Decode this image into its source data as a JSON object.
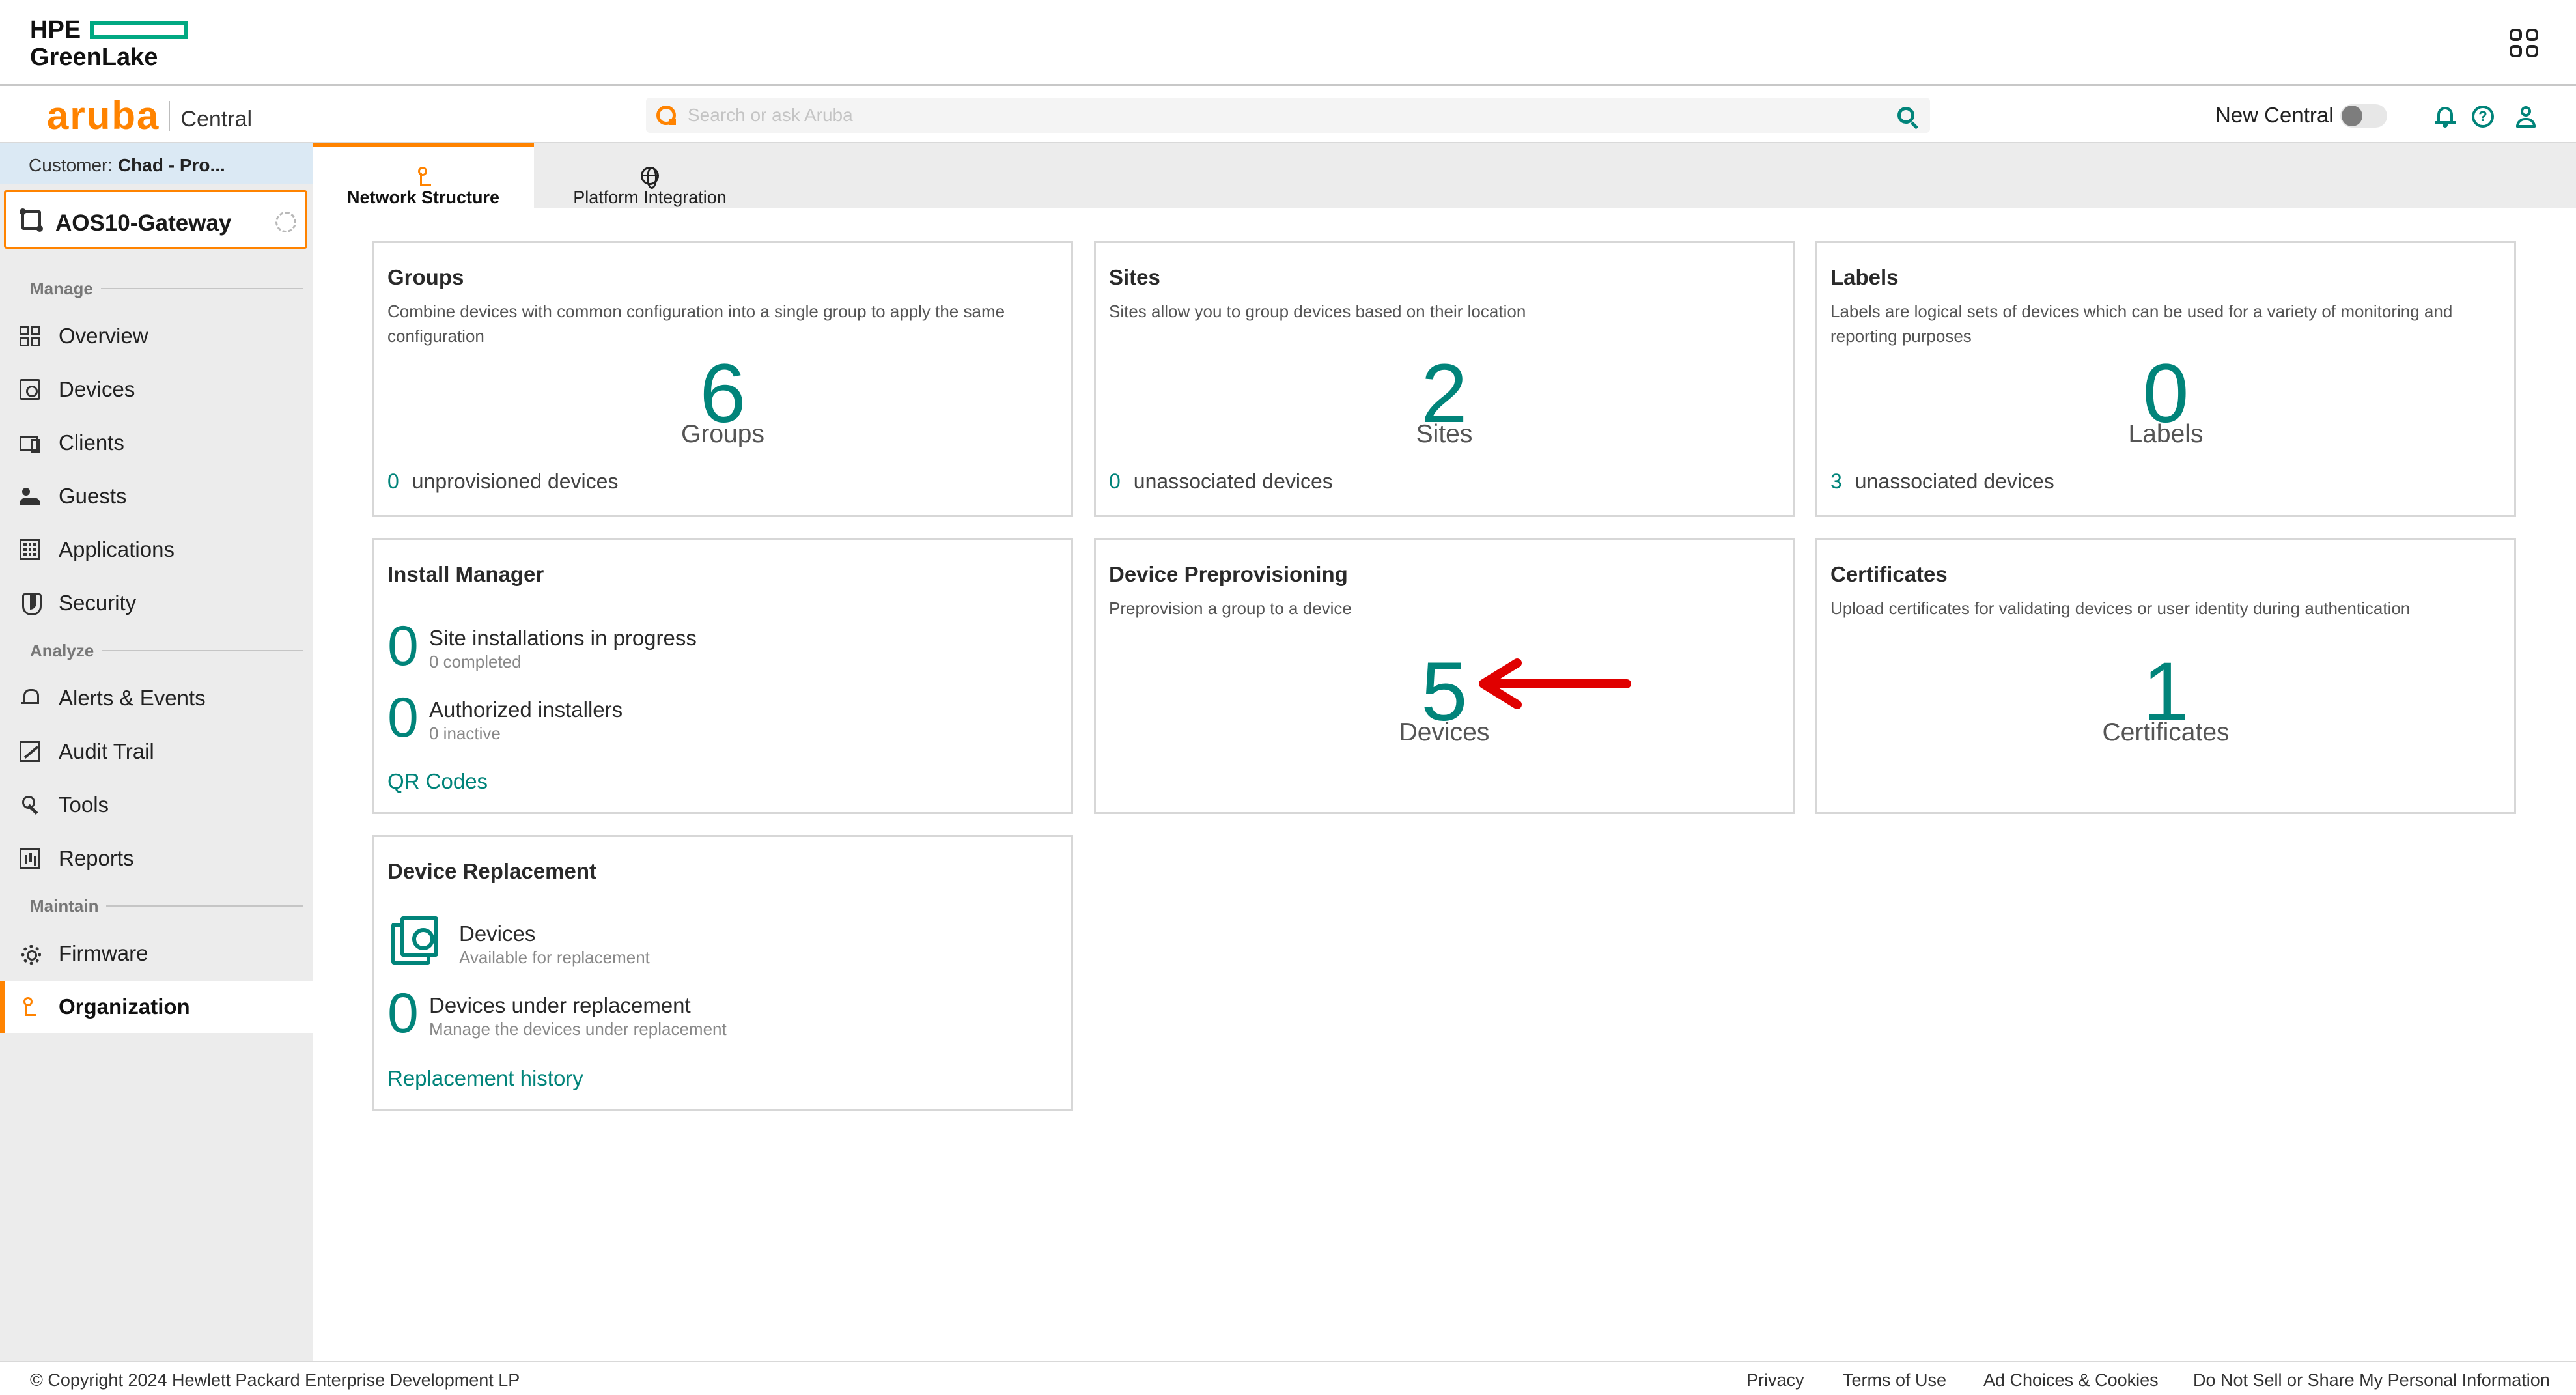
{
  "hpe": {
    "logo_line1": "HPE",
    "logo_line2": "GreenLake"
  },
  "header": {
    "brand": "aruba",
    "product": "Central",
    "search_placeholder": "Search or ask Aruba",
    "new_central_label": "New Central",
    "new_central_enabled": false,
    "help_glyph": "?"
  },
  "sidebar": {
    "customer_label": "Customer:",
    "customer_name": "Chad - Pro...",
    "scope_name": "AOS10-Gateway",
    "sections": {
      "manage": "Manage",
      "analyze": "Analyze",
      "maintain": "Maintain"
    },
    "items": {
      "overview": "Overview",
      "devices": "Devices",
      "clients": "Clients",
      "guests": "Guests",
      "applications": "Applications",
      "security": "Security",
      "alerts": "Alerts & Events",
      "audit": "Audit Trail",
      "tools": "Tools",
      "reports": "Reports",
      "firmware": "Firmware",
      "organization": "Organization"
    },
    "active_item": "organization"
  },
  "tabs": {
    "network_structure": "Network Structure",
    "platform_integration": "Platform Integration",
    "active": "network_structure"
  },
  "cards": {
    "groups": {
      "title": "Groups",
      "desc": "Combine devices with common configuration into a single group to apply the same configuration",
      "count": "6",
      "count_label": "Groups",
      "foot_count": "0",
      "foot_label": "unprovisioned devices"
    },
    "sites": {
      "title": "Sites",
      "desc": "Sites allow you to group devices based on their location",
      "count": "2",
      "count_label": "Sites",
      "foot_count": "0",
      "foot_label": "unassociated devices"
    },
    "labels": {
      "title": "Labels",
      "desc": "Labels are logical sets of devices which can be used for a variety of monitoring and reporting purposes",
      "count": "0",
      "count_label": "Labels",
      "foot_count": "3",
      "foot_label": "unassociated devices"
    },
    "install_manager": {
      "title": "Install Manager",
      "site_count": "0",
      "site_title": "Site installations in progress",
      "site_sub": "0 completed",
      "inst_count": "0",
      "inst_title": "Authorized installers",
      "inst_sub": "0 inactive",
      "link": "QR Codes"
    },
    "preprovisioning": {
      "title": "Device Preprovisioning",
      "desc": "Preprovision a group to a device",
      "count": "5",
      "count_label": "Devices"
    },
    "certificates": {
      "title": "Certificates",
      "desc": "Upload certificates for validating devices or user identity during authentication",
      "count": "1",
      "count_label": "Certificates"
    },
    "replacement": {
      "title": "Device Replacement",
      "dev_title": "Devices",
      "dev_sub": "Available for replacement",
      "under_count": "0",
      "under_title": "Devices under replacement",
      "under_sub": "Manage the devices under replacement",
      "link": "Replacement history"
    }
  },
  "icons": {
    "apps": "apps-grid-icon",
    "search": "search-icon",
    "bell": "bell-icon",
    "help": "help-icon",
    "user": "user-icon",
    "annotation_arrow_color": "#e00000"
  },
  "colors": {
    "accent": "#ff8300",
    "teal": "#01847a",
    "hpe_green": "#01a982"
  },
  "footer": {
    "copyright": "© Copyright 2024 Hewlett Packard Enterprise Development LP",
    "privacy": "Privacy",
    "terms": "Terms of Use",
    "ad_choices": "Ad Choices & Cookies",
    "do_not_sell": "Do Not Sell or Share My Personal Information"
  }
}
